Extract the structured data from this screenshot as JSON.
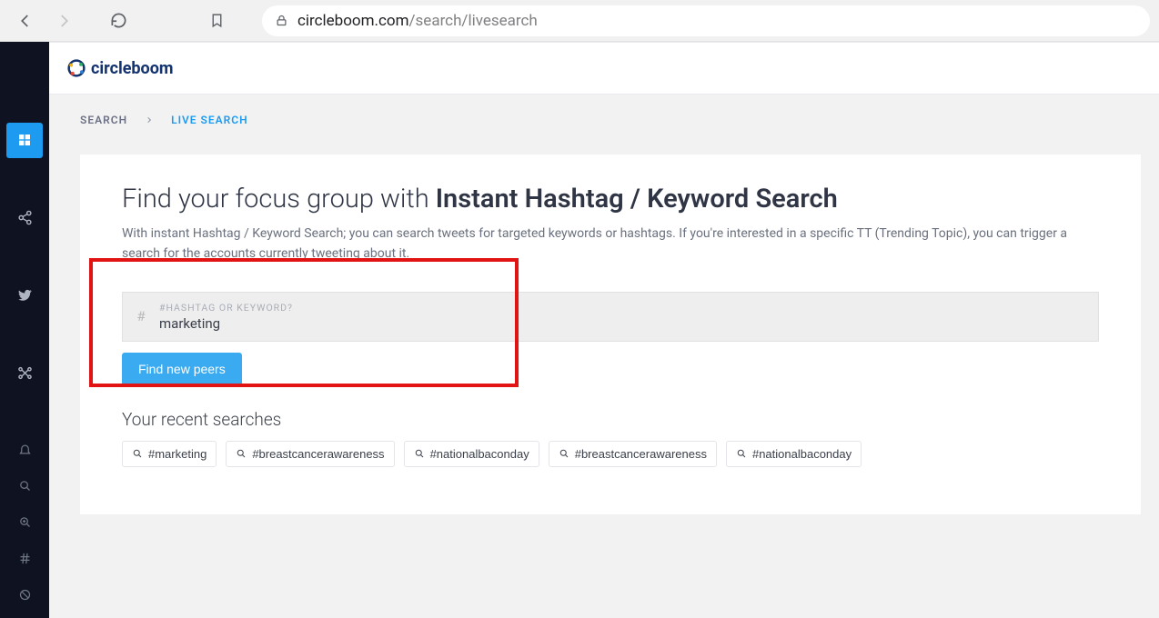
{
  "browser": {
    "url_domain": "circleboom.com",
    "url_path": "/search/livesearch"
  },
  "logo": {
    "text": "circleboom"
  },
  "breadcrumb": {
    "root": "Search",
    "current": "Live Search"
  },
  "page": {
    "title_light": "Find your focus group with ",
    "title_bold": "Instant Hashtag / Keyword Search",
    "description": "With instant Hashtag / Keyword Search; you can search tweets for targeted keywords or hashtags. If you're interested in a specific TT (Trending Topic), you can trigger a search for the accounts currently tweeting about it."
  },
  "search": {
    "hash_prefix": "#",
    "placeholder_label": "#Hashtag or Keyword?",
    "value": "marketing",
    "button_label": "Find new peers"
  },
  "recent": {
    "heading": "Your recent searches",
    "items": [
      {
        "label": "#marketing"
      },
      {
        "label": "#breastcancerawareness"
      },
      {
        "label": "#nationalbaconday"
      },
      {
        "label": "#breastcancerawareness"
      },
      {
        "label": "#nationalbaconday"
      }
    ]
  }
}
